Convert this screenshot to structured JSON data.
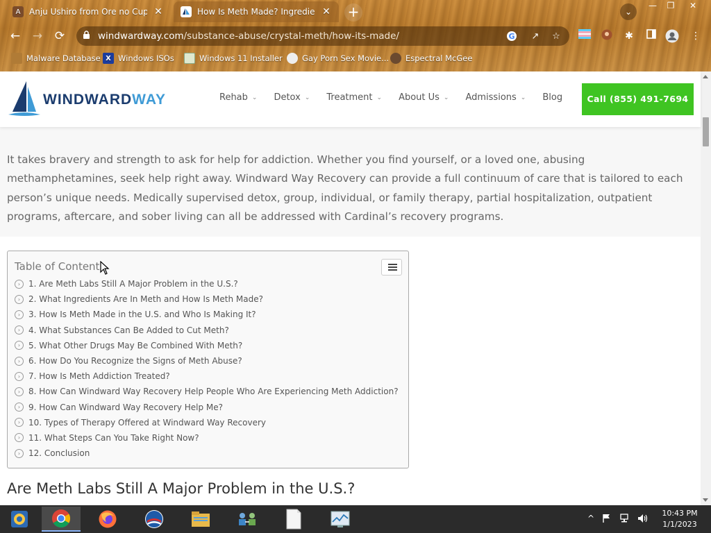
{
  "browser": {
    "tabs": [
      {
        "title": "Anju Ushiro from Ore no Cupid ga",
        "close": "✕",
        "active": false
      },
      {
        "title": "How Is Meth Made? Ingredients",
        "close": "✕",
        "active": true
      }
    ],
    "new_tab": "+",
    "tab_search": "⌄",
    "window_controls": {
      "minimize": "—",
      "restore": "❐",
      "close": "✕"
    },
    "nav": {
      "back": "←",
      "forward": "→",
      "reload": "⟳"
    },
    "url_host": "windwardway.com",
    "url_path": "/substance-abuse/crystal-meth/how-its-made/",
    "bookmarks": [
      {
        "label": "Malware Database",
        "icon": "bookmark-folder-icon"
      },
      {
        "label": "Windows ISOs",
        "icon": "x-icon"
      },
      {
        "label": "Windows 11 Installer",
        "icon": "image-icon"
      },
      {
        "label": "Gay Porn Sex Movie...",
        "icon": "bookmark-icon"
      },
      {
        "label": "Espectral McGee",
        "icon": "avatar-icon"
      }
    ]
  },
  "site": {
    "logo_part1": "WINDWARD",
    "logo_part2": "WAY",
    "nav": [
      {
        "label": "Rehab",
        "has_dropdown": true
      },
      {
        "label": "Detox",
        "has_dropdown": true
      },
      {
        "label": "Treatment",
        "has_dropdown": true
      },
      {
        "label": "About Us",
        "has_dropdown": true
      },
      {
        "label": "Admissions",
        "has_dropdown": true
      },
      {
        "label": "Blog",
        "has_dropdown": false
      }
    ],
    "call_button": "Call (855) 491-7694",
    "colors": {
      "call_green": "#3fc422",
      "logo_navy": "#1b3c6e",
      "logo_blue": "#3f9bd6"
    }
  },
  "article": {
    "intro": "It takes bravery and strength to ask for help for addiction. Whether you find yourself, or a loved one, abusing methamphetamines, seek help right away. Windward Way Recovery can provide a full continuum of care that is tailored to each person’s unique needs. Medically supervised detox, group, individual, or family therapy, partial hospitalization, outpatient programs, aftercare, and sober living can all be addressed with Cardinal’s recovery programs.",
    "toc_title": "Table of Contents",
    "toc_items": [
      "1. Are Meth Labs Still A Major Problem in the U.S.?",
      "2. What Ingredients Are In Meth and How Is Meth Made?",
      "3. How Is Meth Made in the U.S. and Who Is Making It?",
      "4. What Substances Can Be Added to Cut Meth?",
      "5. What Other Drugs May Be Combined With Meth?",
      "6. How Do You Recognize the Signs of Meth Abuse?",
      "7. How Is Meth Addiction Treated?",
      "8. How Can Windward Way Recovery Help People Who Are Experiencing Meth Addiction?",
      "9. How Can Windward Way Recovery Help Me?",
      "10. Types of Therapy Offered at Windward Way Recovery",
      "11. What Steps Can You Take Right Now?",
      "12. Conclusion"
    ],
    "heading": "Are Meth Labs Still A Major Problem in the U.S.?"
  },
  "taskbar": {
    "apps": [
      "chrome-canary-icon",
      "chrome-icon",
      "firefox-icon",
      "obama-icon",
      "file-explorer-icon",
      "network-users-icon",
      "notepad-icon",
      "task-manager-icon"
    ],
    "time": "10:43 PM",
    "date": "1/1/2023"
  }
}
